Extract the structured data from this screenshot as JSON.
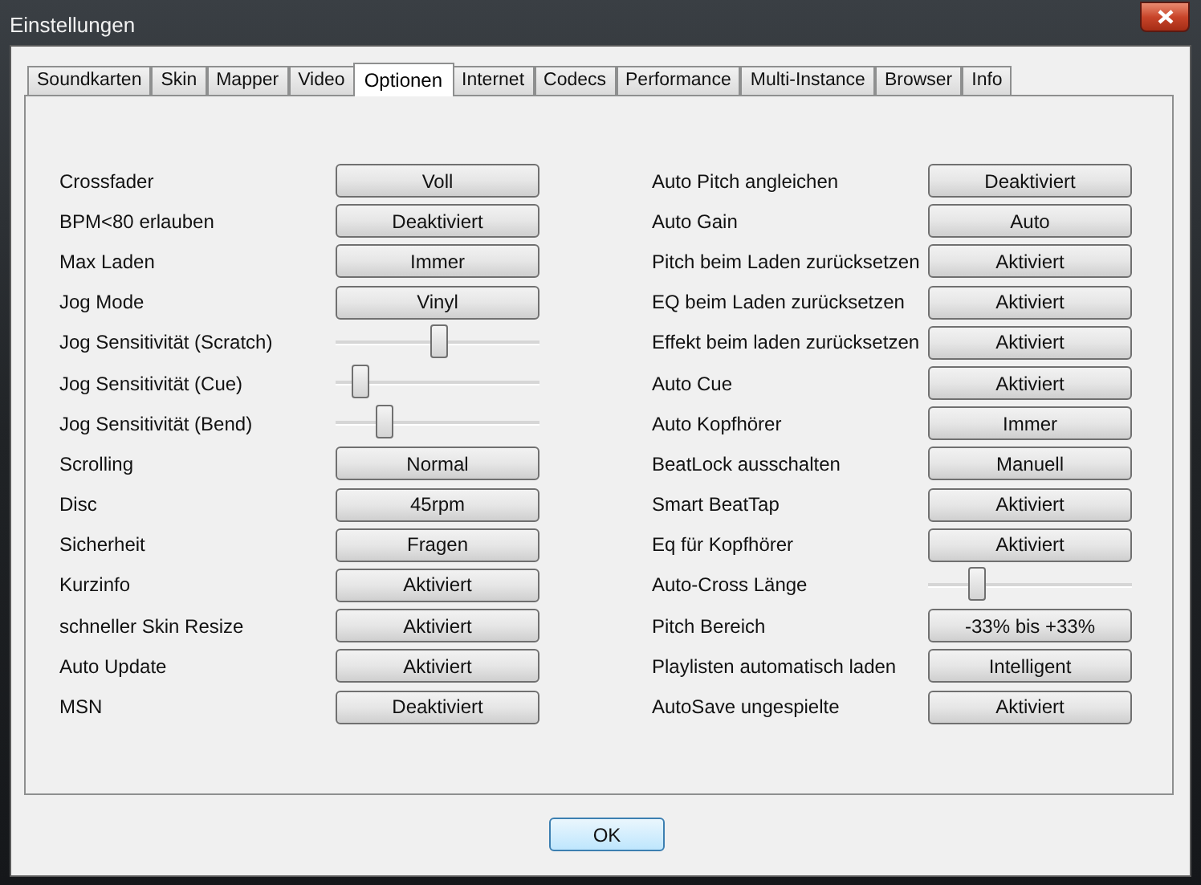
{
  "window": {
    "title": "Einstellungen"
  },
  "tabs": [
    {
      "label": "Soundkarten",
      "selected": false
    },
    {
      "label": "Skin",
      "selected": false
    },
    {
      "label": "Mapper",
      "selected": false
    },
    {
      "label": "Video",
      "selected": false
    },
    {
      "label": "Optionen",
      "selected": true
    },
    {
      "label": "Internet",
      "selected": false
    },
    {
      "label": "Codecs",
      "selected": false
    },
    {
      "label": "Performance",
      "selected": false
    },
    {
      "label": "Multi-Instance",
      "selected": false
    },
    {
      "label": "Browser",
      "selected": false
    },
    {
      "label": "Info",
      "selected": false
    }
  ],
  "left_settings": [
    {
      "label": "Crossfader",
      "kind": "button",
      "value": "Voll"
    },
    {
      "label": "BPM<80 erlauben",
      "kind": "button",
      "value": "Deaktiviert"
    },
    {
      "label": "Max Laden",
      "kind": "button",
      "value": "Immer"
    },
    {
      "label": "Jog Mode",
      "kind": "button",
      "value": "Vinyl"
    },
    {
      "label": "Jog Sensitivität (Scratch)",
      "kind": "slider",
      "level": 0.5
    },
    {
      "label": "Jog Sensitivität (Cue)",
      "kind": "slider",
      "level": 0.12
    },
    {
      "label": "Jog Sensitivität (Bend)",
      "kind": "slider",
      "level": 0.24
    },
    {
      "label": "Scrolling",
      "kind": "button",
      "value": "Normal"
    },
    {
      "label": "Disc",
      "kind": "button",
      "value": "45rpm"
    },
    {
      "label": "Sicherheit",
      "kind": "button",
      "value": "Fragen"
    },
    {
      "label": "Kurzinfo",
      "kind": "button",
      "value": "Aktiviert"
    },
    {
      "label": "schneller Skin Resize",
      "kind": "button",
      "value": "Aktiviert"
    },
    {
      "label": "Auto Update",
      "kind": "button",
      "value": "Aktiviert"
    },
    {
      "label": "MSN",
      "kind": "button",
      "value": "Deaktiviert"
    }
  ],
  "right_settings": [
    {
      "label": "Auto Pitch angleichen",
      "kind": "button",
      "value": "Deaktiviert"
    },
    {
      "label": "Auto Gain",
      "kind": "button",
      "value": "Auto"
    },
    {
      "label": "Pitch beim Laden zurücksetzen",
      "kind": "button",
      "value": "Aktiviert"
    },
    {
      "label": "EQ beim Laden zurücksetzen",
      "kind": "button",
      "value": "Aktiviert"
    },
    {
      "label": "Effekt beim laden zurücksetzen",
      "kind": "button",
      "value": "Aktiviert"
    },
    {
      "label": "Auto Cue",
      "kind": "button",
      "value": "Aktiviert"
    },
    {
      "label": "Auto Kopfhörer",
      "kind": "button",
      "value": "Immer"
    },
    {
      "label": "BeatLock ausschalten",
      "kind": "button",
      "value": "Manuell"
    },
    {
      "label": "Smart BeatTap",
      "kind": "button",
      "value": "Aktiviert"
    },
    {
      "label": "Eq für Kopfhörer",
      "kind": "button",
      "value": "Aktiviert"
    },
    {
      "label": "Auto-Cross Länge",
      "kind": "slider",
      "level": 0.24
    },
    {
      "label": "Pitch Bereich",
      "kind": "button",
      "value": "-33% bis +33%"
    },
    {
      "label": "Playlisten automatisch laden",
      "kind": "button",
      "value": "Intelligent"
    },
    {
      "label": "AutoSave ungespielte",
      "kind": "button",
      "value": "Aktiviert"
    }
  ],
  "ok_button": "OK"
}
